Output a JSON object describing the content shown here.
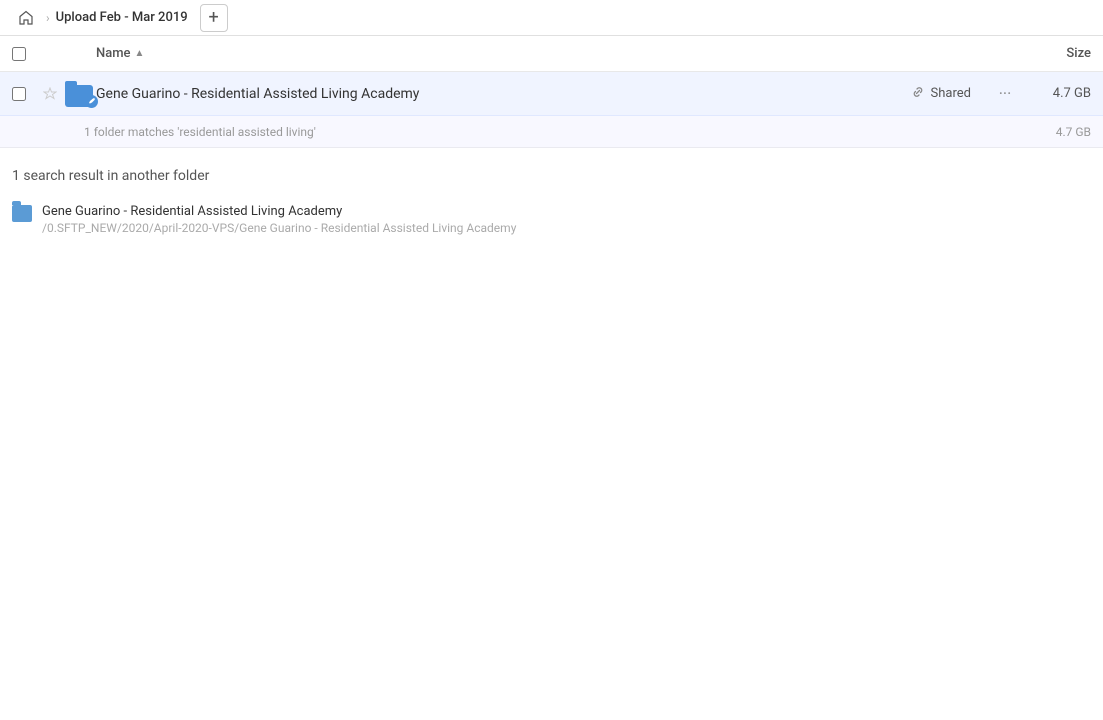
{
  "header": {
    "home_icon": "home",
    "breadcrumb_arrow": "›",
    "title": "Upload Feb - Mar 2019",
    "add_button_label": "+"
  },
  "columns": {
    "name_label": "Name",
    "sort_indicator": "▲",
    "size_label": "Size"
  },
  "main_item": {
    "name": "Gene Guarino - Residential Assisted Living Academy",
    "shared_label": "Shared",
    "size": "4.7 GB",
    "match_text": "1 folder matches 'residential assisted living'",
    "match_size": "4.7 GB"
  },
  "search_results": {
    "heading": "1 search result in another folder",
    "items": [
      {
        "name": "Gene Guarino - Residential Assisted Living Academy",
        "path": "/0.SFTP_NEW/2020/April-2020-VPS/Gene Guarino - Residential Assisted Living Academy"
      }
    ]
  }
}
